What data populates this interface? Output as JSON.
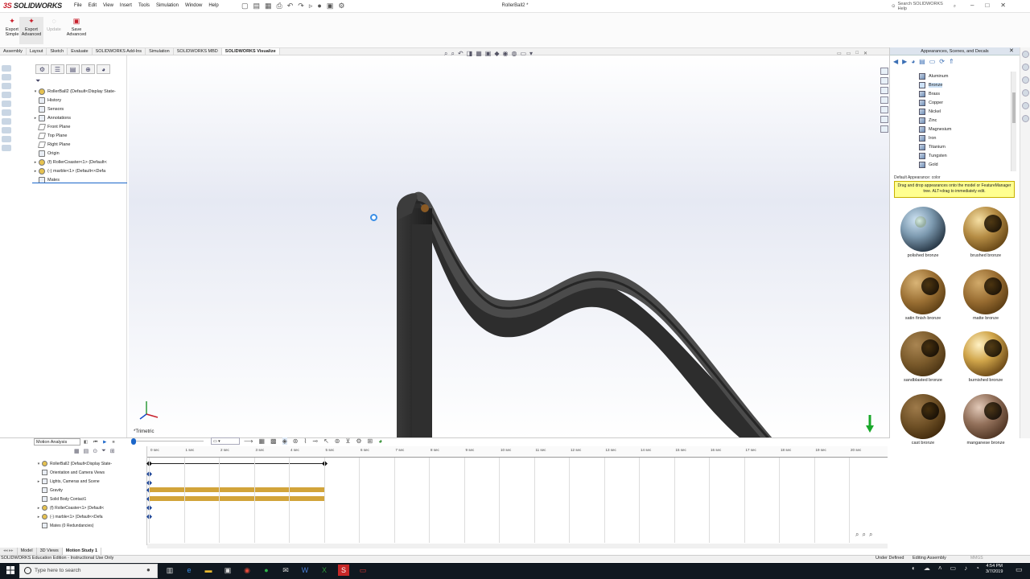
{
  "app": {
    "logo_prefix": "3S",
    "logo_text": "SOLIDWORKS",
    "document_title": "RollerBall2 *",
    "help_search_placeholder": "Search SOLIDWORKS Help"
  },
  "menus": [
    "File",
    "Edit",
    "View",
    "Insert",
    "Tools",
    "Simulation",
    "Window",
    "Help"
  ],
  "ribbon": {
    "export_simple": "Export\nSimple",
    "export_advanced": "Export\nAdvanced",
    "update": "Update",
    "save_advanced": "Save\nAdvanced"
  },
  "command_tabs": [
    "Assembly",
    "Layout",
    "Sketch",
    "Evaluate",
    "SOLIDWORKS Add-Ins",
    "Simulation",
    "SOLIDWORKS MBD",
    "SOLIDWORKS Visualize"
  ],
  "command_tabs_active": "SOLIDWORKS Visualize",
  "feature_tree": [
    {
      "label": "RollerBall2  (Default<Display State-",
      "icon": "assembly-icon",
      "expand": "▾"
    },
    {
      "label": "History",
      "icon": "history-icon",
      "expand": ""
    },
    {
      "label": "Sensors",
      "icon": "sensors-icon",
      "expand": ""
    },
    {
      "label": "Annotations",
      "icon": "annotations-icon",
      "expand": "▸"
    },
    {
      "label": "Front Plane",
      "icon": "plane-icon",
      "expand": ""
    },
    {
      "label": "Top Plane",
      "icon": "plane-icon",
      "expand": ""
    },
    {
      "label": "Right Plane",
      "icon": "plane-icon",
      "expand": ""
    },
    {
      "label": "Origin",
      "icon": "origin-icon",
      "expand": ""
    },
    {
      "label": "(f) RollerCoaster<1> (Default<",
      "icon": "part-icon",
      "expand": "▸"
    },
    {
      "label": "(-) marble<1> (Default<<Defa",
      "icon": "part-icon",
      "expand": "▸"
    },
    {
      "label": "Mates",
      "icon": "mates-icon",
      "expand": ""
    }
  ],
  "viewport": {
    "view_label": "*Trimetric"
  },
  "task_pane": {
    "title": "Appearances, Scenes, and Decals",
    "materials": [
      "Aluminum",
      "Bronze",
      "Brass",
      "Copper",
      "Nickel",
      "Zinc",
      "Magnesium",
      "Iron",
      "Titanium",
      "Tungsten",
      "Gold"
    ],
    "selected_material": "Bronze",
    "default_appearance": "Default Appearance: color",
    "tip": "Drag and drop appearances onto the model or FeatureManager tree. ALT+drag to immediately edit.",
    "swatches": [
      {
        "label": "polished bronze",
        "style": "b-pol"
      },
      {
        "label": "brushed bronze",
        "style": "b-br"
      },
      {
        "label": "satin finish bronze",
        "style": "b-sat"
      },
      {
        "label": "matte bronze",
        "style": "b-mat"
      },
      {
        "label": "sandblasted bronze",
        "style": "b-sand"
      },
      {
        "label": "burnished bronze",
        "style": "b-burn"
      },
      {
        "label": "cast bronze",
        "style": "b-cast"
      },
      {
        "label": "manganese bronze",
        "style": "b-man"
      }
    ]
  },
  "motion": {
    "study_type": "Motion Analysis",
    "tree": [
      {
        "label": "RollerBall2  (Default<Display State-",
        "expand": "▾",
        "icon": "y"
      },
      {
        "label": "Orientation and Camera Views",
        "expand": "",
        "icon": ""
      },
      {
        "label": "Lights, Cameras and Scene",
        "expand": "▸",
        "icon": ""
      },
      {
        "label": "Gravity",
        "expand": "",
        "icon": ""
      },
      {
        "label": "Solid Body Contact1",
        "expand": "",
        "icon": ""
      },
      {
        "label": "(f) RollerCoaster<1> (Default<",
        "expand": "▸",
        "icon": "y"
      },
      {
        "label": "(-) marble<1> (Default<<Defa",
        "expand": "▸",
        "icon": "y"
      },
      {
        "label": "Mates (0 Redundancies)",
        "expand": "",
        "icon": ""
      }
    ],
    "ticks": [
      "0 sec",
      "1 sec",
      "2 sec",
      "3 sec",
      "4 sec",
      "5 sec",
      "6 sec",
      "7 sec",
      "8 sec",
      "9 sec",
      "10 sec",
      "11 sec",
      "12 sec",
      "13 sec",
      "14 sec",
      "15 sec",
      "16 sec",
      "17 sec",
      "18 sec",
      "19 sec",
      "20 sec"
    ],
    "bottom_tabs": [
      "Model",
      "3D Views",
      "Motion Study 1"
    ],
    "active_tab": "Motion Study 1"
  },
  "status": {
    "edition": "SOLIDWORKS Education Edition - Instructional Use Only",
    "under_defined": "Under Defined",
    "editing": "Editing Assembly",
    "units": "MMGS"
  },
  "taskbar": {
    "search_placeholder": "Type here to search",
    "time": "4:54 PM",
    "date": "3/7/2019"
  }
}
